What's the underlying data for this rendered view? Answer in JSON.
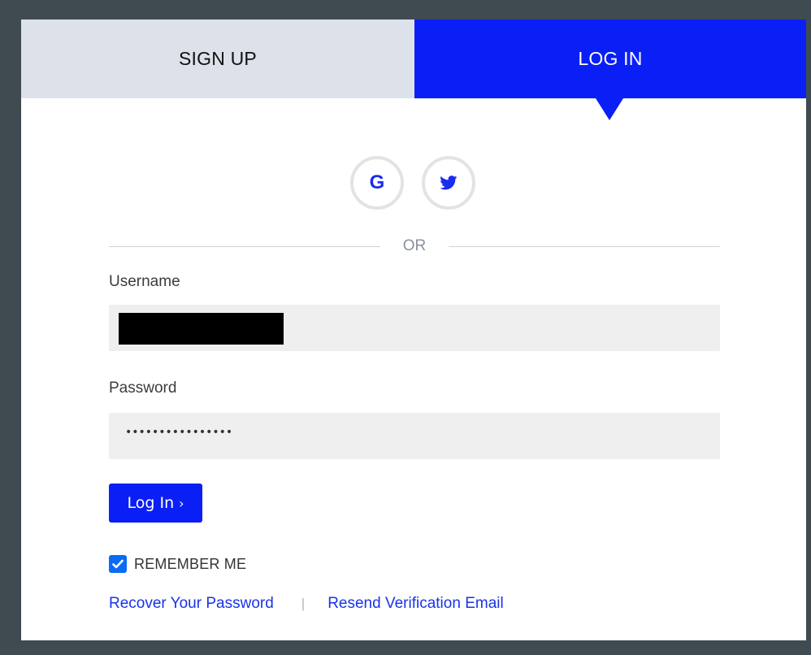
{
  "tabs": {
    "signup_label": "SIGN UP",
    "login_label": "LOG IN",
    "active": "login"
  },
  "social": {
    "google_glyph": "G",
    "google_icon": "google-icon",
    "twitter_icon": "twitter-icon"
  },
  "divider": {
    "text": "OR"
  },
  "form": {
    "username_label": "Username",
    "username_value": "",
    "password_label": "Password",
    "password_value": "••••••••••••••••",
    "submit_label": "Log In",
    "submit_chevron": "›",
    "remember_label": "REMEMBER ME",
    "remember_checked": true
  },
  "links": {
    "recover": "Recover Your Password",
    "separator": "|",
    "resend": "Resend Verification Email"
  },
  "colors": {
    "brand_blue": "#0a1ff5",
    "tab_inactive_bg": "#dde1ea",
    "page_bg": "#3f4b51",
    "input_bg": "#efefef",
    "link_blue": "#1a33e8",
    "checkbox_blue": "#0a6cf5"
  }
}
